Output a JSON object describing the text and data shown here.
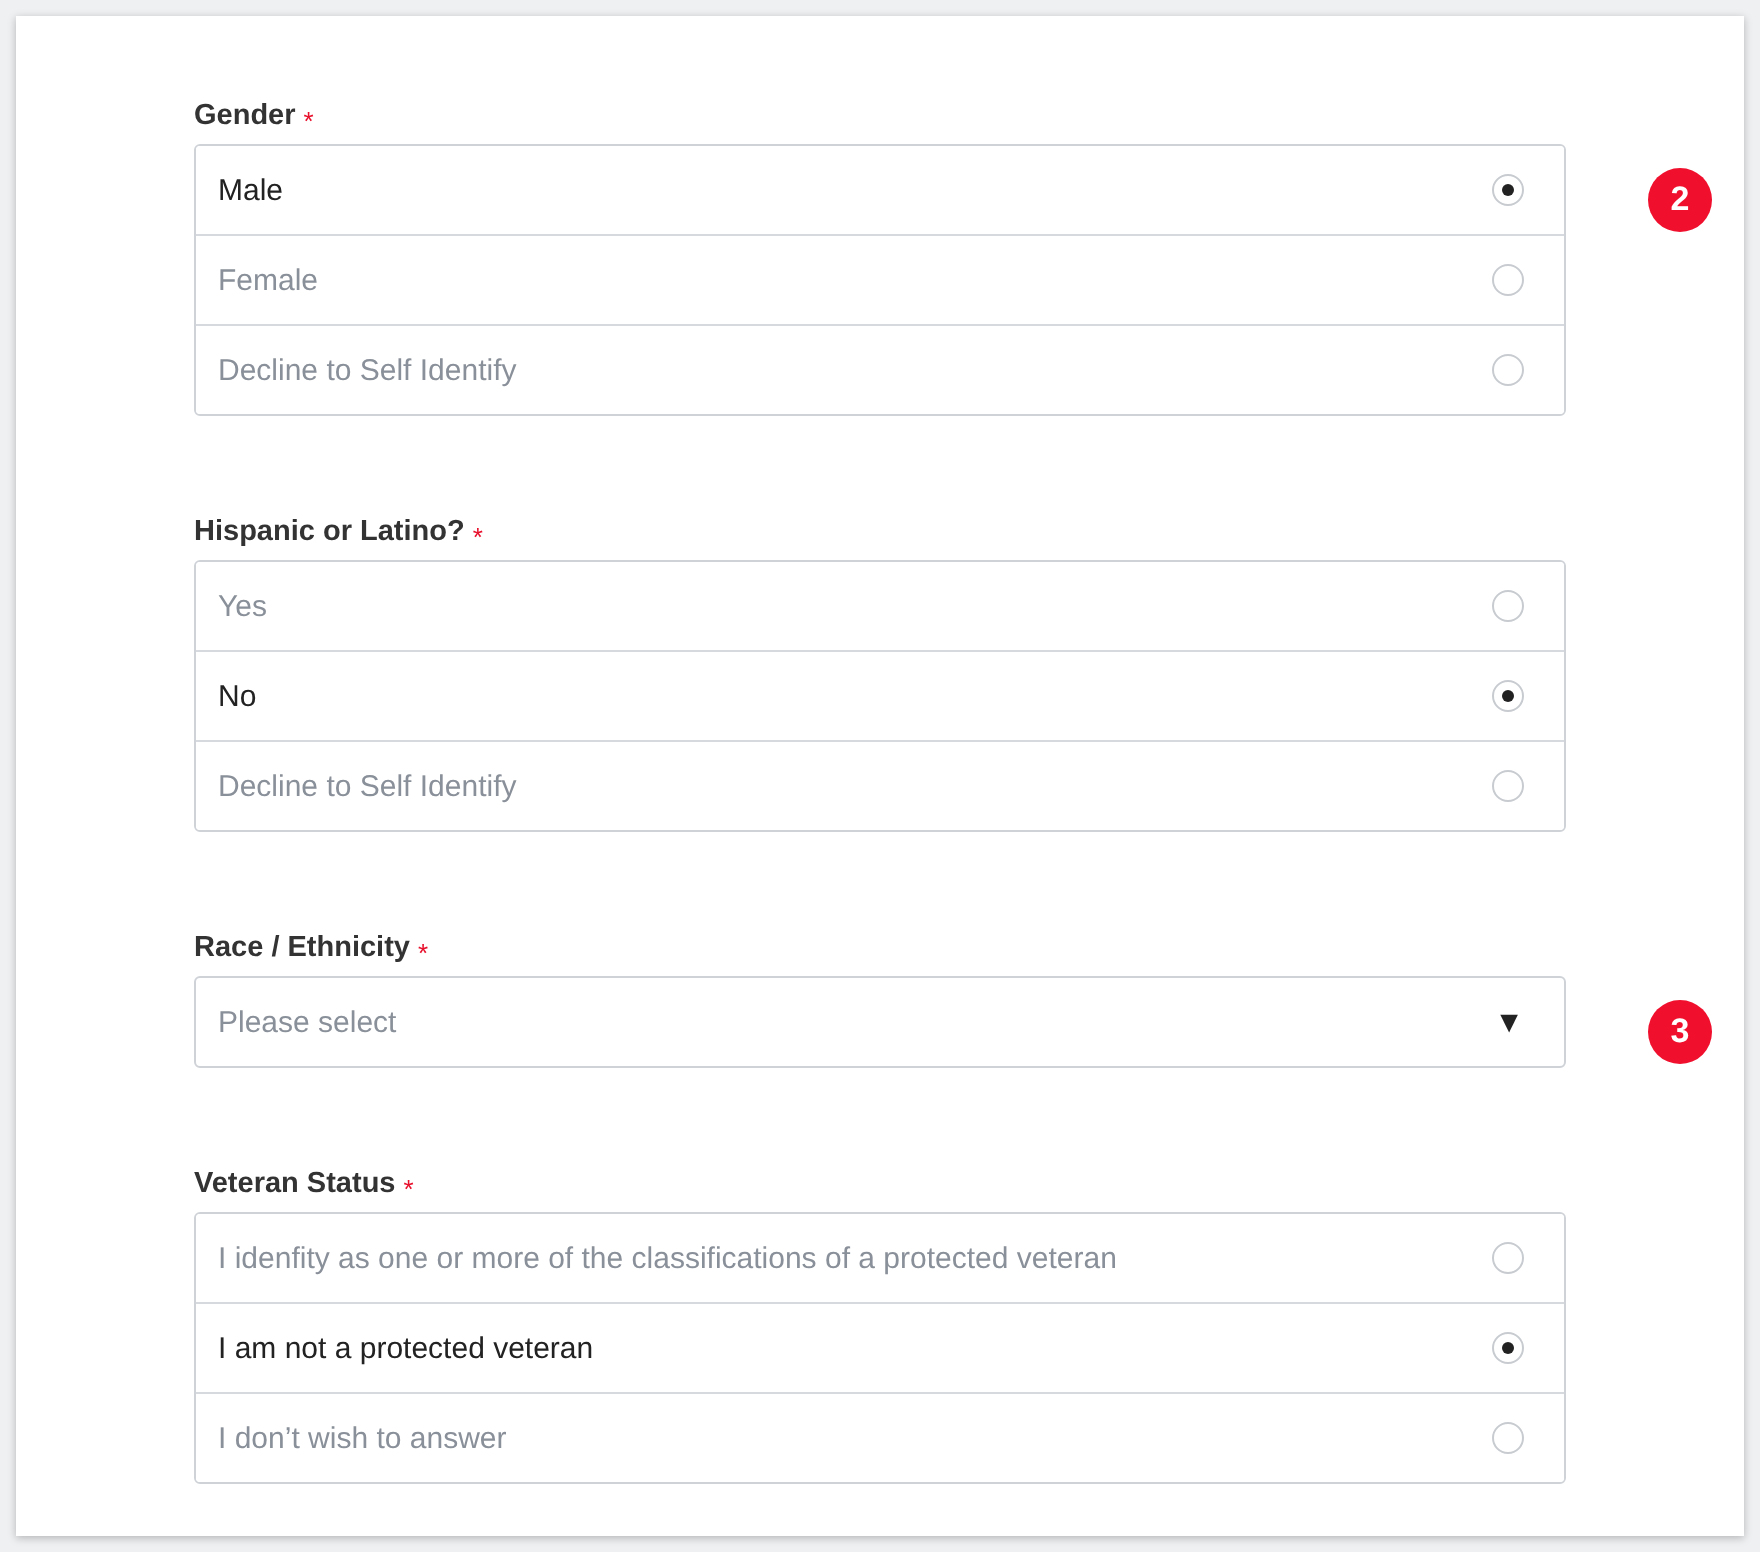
{
  "sections": [
    {
      "kind": "radio",
      "label": "Gender",
      "required_mark": "*",
      "badge": "2",
      "options": [
        {
          "label": "Male",
          "selected": true
        },
        {
          "label": "Female",
          "selected": false
        },
        {
          "label": "Decline to Self Identify",
          "selected": false
        }
      ]
    },
    {
      "kind": "radio",
      "label": "Hispanic or Latino?",
      "required_mark": "*",
      "options": [
        {
          "label": "Yes",
          "selected": false
        },
        {
          "label": "No",
          "selected": true
        },
        {
          "label": "Decline to Self Identify",
          "selected": false
        }
      ]
    },
    {
      "kind": "select",
      "label": "Race / Ethnicity",
      "required_mark": "*",
      "badge": "3",
      "placeholder": "Please select",
      "caret": "▼"
    },
    {
      "kind": "radio",
      "label": "Veteran Status",
      "required_mark": "*",
      "options": [
        {
          "label": "I idenfity as one or more of the classifications of a protected veteran",
          "selected": false
        },
        {
          "label": "I am not a protected veteran",
          "selected": true
        },
        {
          "label": "I don’t wish to answer",
          "selected": false
        }
      ]
    }
  ]
}
